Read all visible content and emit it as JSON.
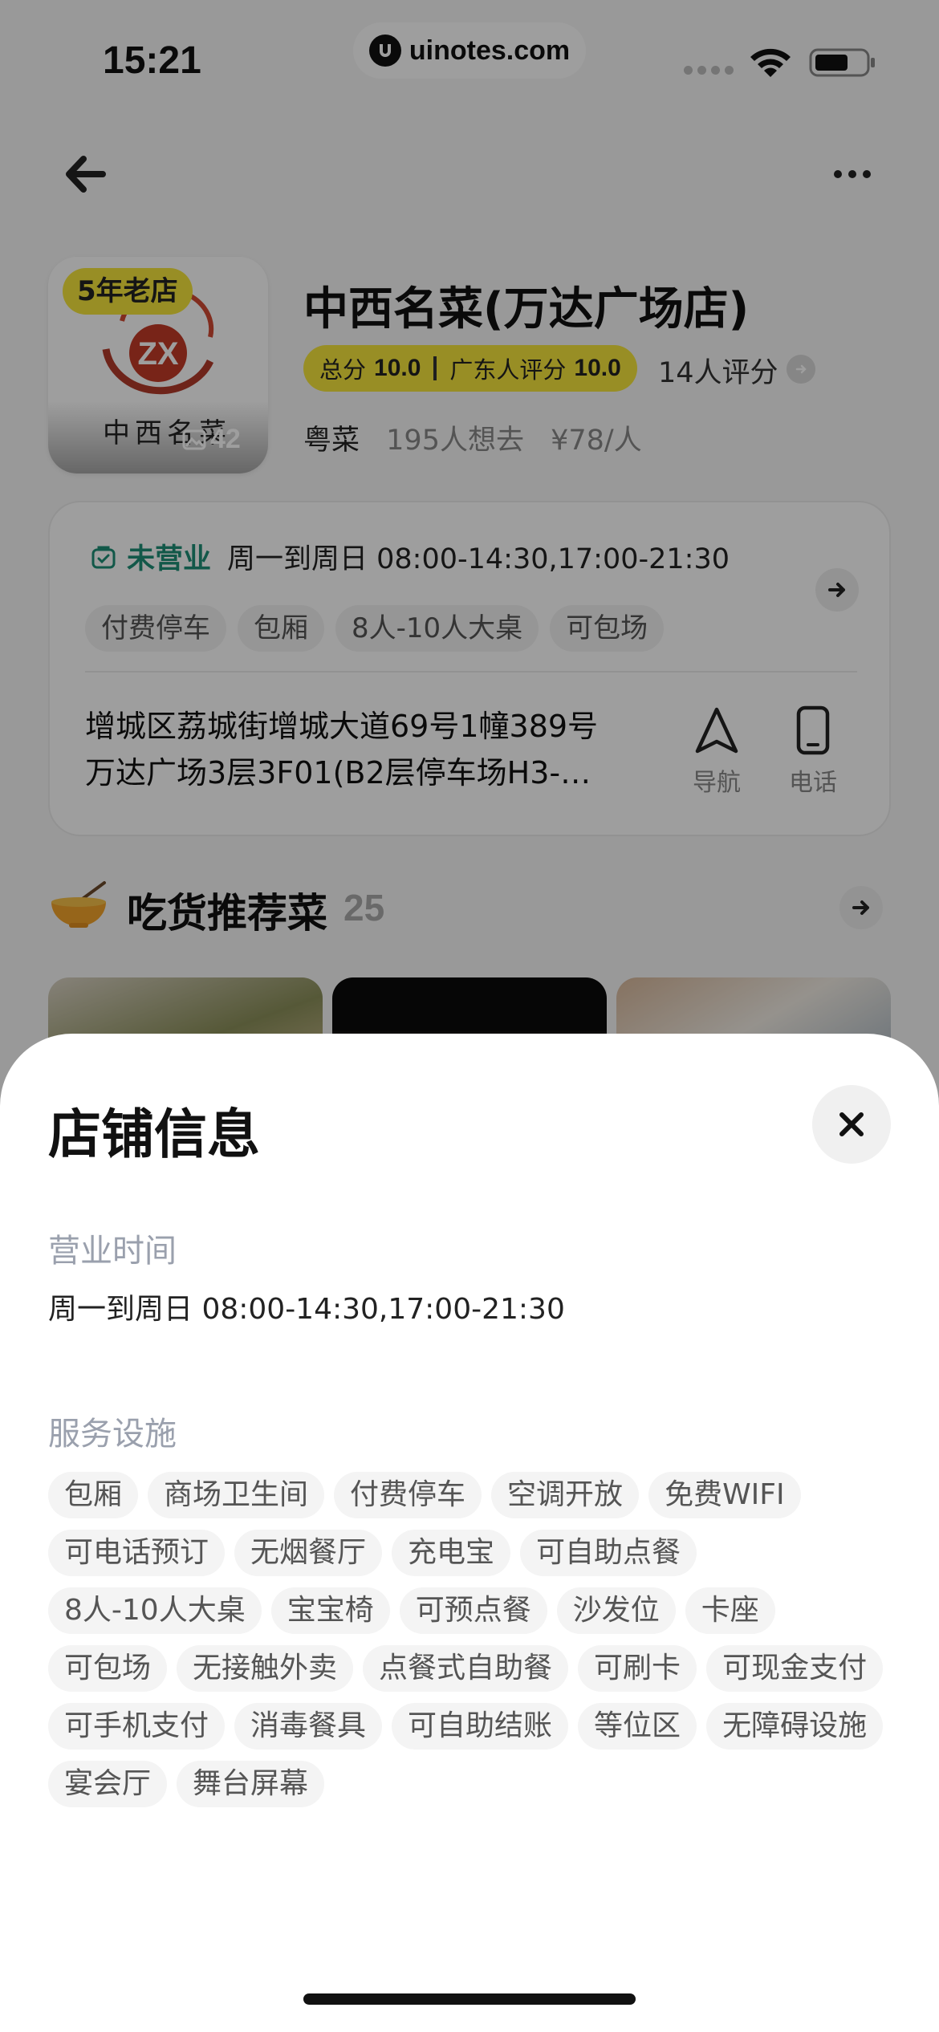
{
  "status_bar": {
    "time": "15:21",
    "watermark": "uinotes.com"
  },
  "store": {
    "age_badge": "5年老店",
    "photo_count": "42",
    "thumb_calligraphy": "中西名菜",
    "thumb_logo_text": "ZX",
    "name": "中西名菜(万达广场店)",
    "score_label": "总分",
    "score_value": "10.0",
    "local_score_label": "广东人评分",
    "local_score_value": "10.0",
    "review_count": "14人评分",
    "cuisine": "粤菜",
    "want_to_go": "195人想去",
    "price": "¥78/人"
  },
  "info_card": {
    "status": "未营业",
    "hours": "周一到周日 08:00-14:30,17:00-21:30",
    "tags": [
      "付费停车",
      "包厢",
      "8人-10人大桌",
      "可包场"
    ],
    "address_line1": "增城区荔城街增城大道69号1幢389号",
    "address_line2": "万达广场3层3F01(B2层停车场H3-…",
    "nav_label": "导航",
    "phone_label": "电话"
  },
  "recommend": {
    "title": "吃货推荐菜",
    "count": "25"
  },
  "sheet": {
    "title": "店铺信息",
    "hours_label": "营业时间",
    "hours_value": "周一到周日 08:00-14:30,17:00-21:30",
    "services_label": "服务设施",
    "services": [
      "包厢",
      "商场卫生间",
      "付费停车",
      "空调开放",
      "免费WIFI",
      "可电话预订",
      "无烟餐厅",
      "充电宝",
      "可自助点餐",
      "8人-10人大桌",
      "宝宝椅",
      "可预点餐",
      "沙发位",
      "卡座",
      "可包场",
      "无接触外卖",
      "点餐式自助餐",
      "可刷卡",
      "可现金支付",
      "可手机支付",
      "消毒餐具",
      "可自助结账",
      "等位区",
      "无障碍设施",
      "宴会厅",
      "舞台屏幕"
    ]
  },
  "colors": {
    "accent_yellow": "#f6e53c",
    "status_green": "#1e8f76",
    "overlay": "rgba(0,0,0,0.38)"
  }
}
